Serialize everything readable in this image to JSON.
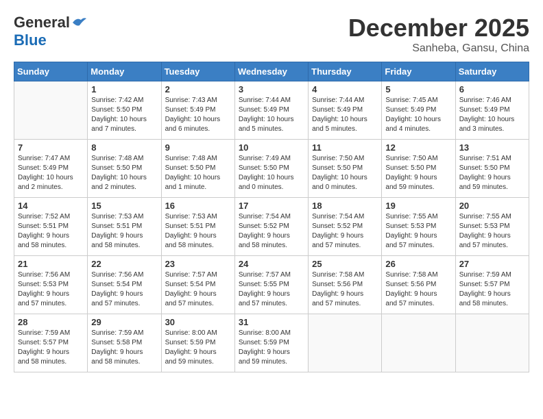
{
  "header": {
    "logo_general": "General",
    "logo_blue": "Blue",
    "month": "December 2025",
    "location": "Sanheba, Gansu, China"
  },
  "calendar": {
    "days_of_week": [
      "Sunday",
      "Monday",
      "Tuesday",
      "Wednesday",
      "Thursday",
      "Friday",
      "Saturday"
    ],
    "weeks": [
      [
        {
          "day": "",
          "info": ""
        },
        {
          "day": "1",
          "info": "Sunrise: 7:42 AM\nSunset: 5:50 PM\nDaylight: 10 hours\nand 7 minutes."
        },
        {
          "day": "2",
          "info": "Sunrise: 7:43 AM\nSunset: 5:49 PM\nDaylight: 10 hours\nand 6 minutes."
        },
        {
          "day": "3",
          "info": "Sunrise: 7:44 AM\nSunset: 5:49 PM\nDaylight: 10 hours\nand 5 minutes."
        },
        {
          "day": "4",
          "info": "Sunrise: 7:44 AM\nSunset: 5:49 PM\nDaylight: 10 hours\nand 5 minutes."
        },
        {
          "day": "5",
          "info": "Sunrise: 7:45 AM\nSunset: 5:49 PM\nDaylight: 10 hours\nand 4 minutes."
        },
        {
          "day": "6",
          "info": "Sunrise: 7:46 AM\nSunset: 5:49 PM\nDaylight: 10 hours\nand 3 minutes."
        }
      ],
      [
        {
          "day": "7",
          "info": "Sunrise: 7:47 AM\nSunset: 5:49 PM\nDaylight: 10 hours\nand 2 minutes."
        },
        {
          "day": "8",
          "info": "Sunrise: 7:48 AM\nSunset: 5:50 PM\nDaylight: 10 hours\nand 2 minutes."
        },
        {
          "day": "9",
          "info": "Sunrise: 7:48 AM\nSunset: 5:50 PM\nDaylight: 10 hours\nand 1 minute."
        },
        {
          "day": "10",
          "info": "Sunrise: 7:49 AM\nSunset: 5:50 PM\nDaylight: 10 hours\nand 0 minutes."
        },
        {
          "day": "11",
          "info": "Sunrise: 7:50 AM\nSunset: 5:50 PM\nDaylight: 10 hours\nand 0 minutes."
        },
        {
          "day": "12",
          "info": "Sunrise: 7:50 AM\nSunset: 5:50 PM\nDaylight: 9 hours\nand 59 minutes."
        },
        {
          "day": "13",
          "info": "Sunrise: 7:51 AM\nSunset: 5:50 PM\nDaylight: 9 hours\nand 59 minutes."
        }
      ],
      [
        {
          "day": "14",
          "info": "Sunrise: 7:52 AM\nSunset: 5:51 PM\nDaylight: 9 hours\nand 58 minutes."
        },
        {
          "day": "15",
          "info": "Sunrise: 7:53 AM\nSunset: 5:51 PM\nDaylight: 9 hours\nand 58 minutes."
        },
        {
          "day": "16",
          "info": "Sunrise: 7:53 AM\nSunset: 5:51 PM\nDaylight: 9 hours\nand 58 minutes."
        },
        {
          "day": "17",
          "info": "Sunrise: 7:54 AM\nSunset: 5:52 PM\nDaylight: 9 hours\nand 58 minutes."
        },
        {
          "day": "18",
          "info": "Sunrise: 7:54 AM\nSunset: 5:52 PM\nDaylight: 9 hours\nand 57 minutes."
        },
        {
          "day": "19",
          "info": "Sunrise: 7:55 AM\nSunset: 5:53 PM\nDaylight: 9 hours\nand 57 minutes."
        },
        {
          "day": "20",
          "info": "Sunrise: 7:55 AM\nSunset: 5:53 PM\nDaylight: 9 hours\nand 57 minutes."
        }
      ],
      [
        {
          "day": "21",
          "info": "Sunrise: 7:56 AM\nSunset: 5:53 PM\nDaylight: 9 hours\nand 57 minutes."
        },
        {
          "day": "22",
          "info": "Sunrise: 7:56 AM\nSunset: 5:54 PM\nDaylight: 9 hours\nand 57 minutes."
        },
        {
          "day": "23",
          "info": "Sunrise: 7:57 AM\nSunset: 5:54 PM\nDaylight: 9 hours\nand 57 minutes."
        },
        {
          "day": "24",
          "info": "Sunrise: 7:57 AM\nSunset: 5:55 PM\nDaylight: 9 hours\nand 57 minutes."
        },
        {
          "day": "25",
          "info": "Sunrise: 7:58 AM\nSunset: 5:56 PM\nDaylight: 9 hours\nand 57 minutes."
        },
        {
          "day": "26",
          "info": "Sunrise: 7:58 AM\nSunset: 5:56 PM\nDaylight: 9 hours\nand 57 minutes."
        },
        {
          "day": "27",
          "info": "Sunrise: 7:59 AM\nSunset: 5:57 PM\nDaylight: 9 hours\nand 58 minutes."
        }
      ],
      [
        {
          "day": "28",
          "info": "Sunrise: 7:59 AM\nSunset: 5:57 PM\nDaylight: 9 hours\nand 58 minutes."
        },
        {
          "day": "29",
          "info": "Sunrise: 7:59 AM\nSunset: 5:58 PM\nDaylight: 9 hours\nand 58 minutes."
        },
        {
          "day": "30",
          "info": "Sunrise: 8:00 AM\nSunset: 5:59 PM\nDaylight: 9 hours\nand 59 minutes."
        },
        {
          "day": "31",
          "info": "Sunrise: 8:00 AM\nSunset: 5:59 PM\nDaylight: 9 hours\nand 59 minutes."
        },
        {
          "day": "",
          "info": ""
        },
        {
          "day": "",
          "info": ""
        },
        {
          "day": "",
          "info": ""
        }
      ]
    ]
  }
}
